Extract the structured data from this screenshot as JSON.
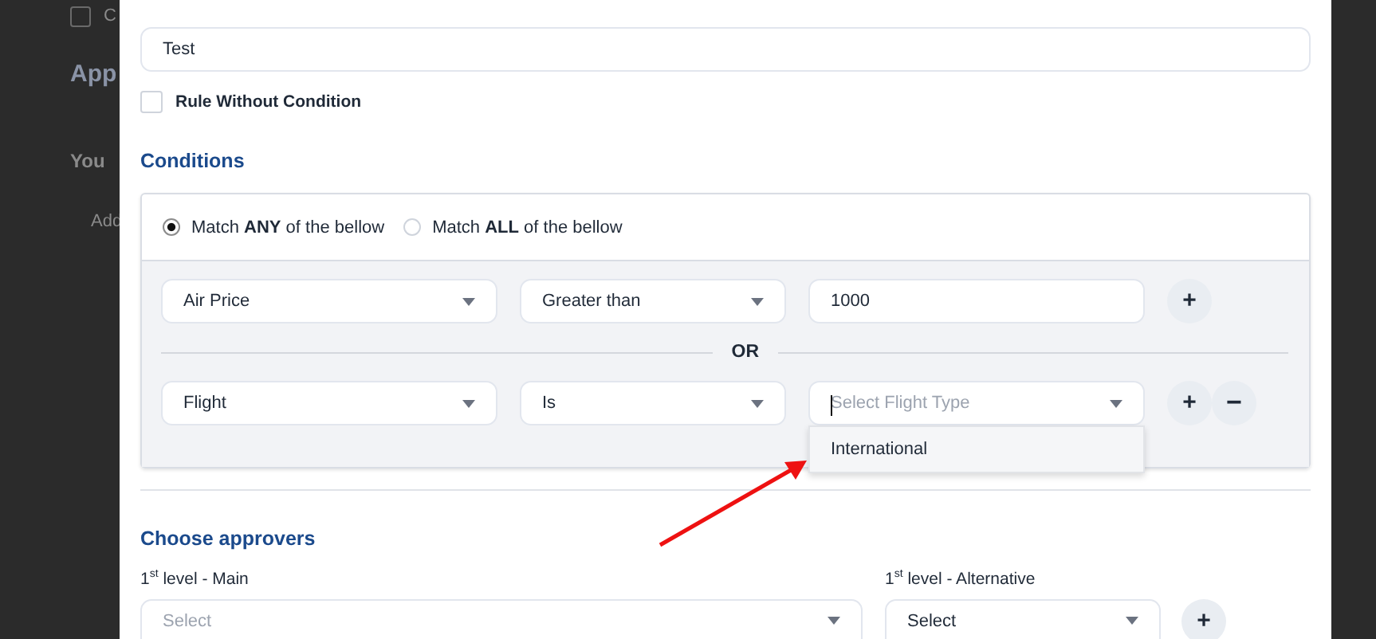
{
  "backdrop": {
    "checked": false,
    "checkbox_label": "C",
    "heading": "App",
    "card_title": "You",
    "card_action": "Add"
  },
  "rule_name": {
    "value": "Test"
  },
  "without_condition": {
    "label": "Rule Without Condition",
    "checked": false
  },
  "conditions": {
    "title": "Conditions",
    "match_options": [
      {
        "label": "Match **ANY** of the bellow",
        "selected": true
      },
      {
        "label": "Match **ALL** of the bellow",
        "selected": false
      }
    ],
    "joiner": "OR",
    "rows": [
      {
        "field": "Air Price",
        "operator": "Greater than",
        "value": {
          "kind": "input",
          "text": "1000"
        },
        "buttons": [
          {
            "kind": "add",
            "label": "+"
          }
        ]
      },
      {
        "field": "Flight",
        "operator": "Is",
        "value": {
          "kind": "select",
          "placeholder": "Select Flight Type",
          "focused": true,
          "options": [
            "International"
          ]
        },
        "buttons": [
          {
            "kind": "add",
            "label": "+"
          },
          {
            "kind": "remove",
            "label": "−"
          }
        ]
      }
    ]
  },
  "approvers": {
    "title": "Choose approvers",
    "levels": [
      {
        "label": "1$^{st}$ level - Main",
        "kind": "placeholder",
        "text": "Select"
      },
      {
        "label": "1$^{st}$ level - Alternative",
        "kind": "value",
        "text": "Select"
      }
    ],
    "button": {
      "label": "+"
    }
  },
  "annotation": {
    "kind": "arrow"
  }
}
